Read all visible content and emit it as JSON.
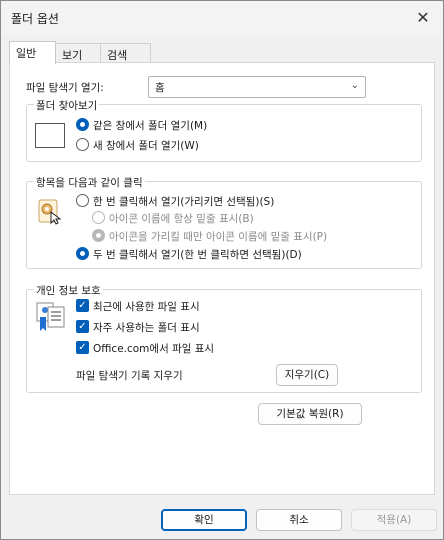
{
  "window": {
    "title": "폴더 옵션",
    "close_icon": "✕"
  },
  "tabs": [
    {
      "label": "일반",
      "active": true
    },
    {
      "label": "보기",
      "active": false
    },
    {
      "label": "검색",
      "active": false
    }
  ],
  "explorer_open": {
    "label": "파일 탐색기 열기:",
    "value": "홈"
  },
  "browse_folders": {
    "title": "폴더 찾아보기",
    "option_same": "같은 창에서 폴더 열기(M)",
    "option_new": "새 창에서 폴더 열기(W)"
  },
  "click_items": {
    "title": "항목을 다음과 같이 클릭",
    "single_click": "한 번 클릭해서 열기(가리키면 선택됨)(S)",
    "underline_always": "아이콘 이름에 항상 밑줄 표시(B)",
    "underline_hover": "아이콘을 가리킬 때만 아이콘 이름에 밑줄 표시(P)",
    "double_click": "두 번 클릭해서 열기(한 번 클릭하면 선택됨)(D)"
  },
  "privacy": {
    "title": "개인 정보 보호",
    "recent_files": "최근에 사용한 파일 표시",
    "frequent_folders": "자주 사용하는 폴더 표시",
    "office_files": "Office.com에서 파일 표시",
    "clear_history_label": "파일 탐색기 기록 지우기",
    "clear_button": "지우기(C)"
  },
  "restore_defaults": "기본값 복원(R)",
  "footer": {
    "ok": "확인",
    "cancel": "취소",
    "apply": "적용(A)"
  },
  "colors": {
    "accent": "#005fb8"
  }
}
